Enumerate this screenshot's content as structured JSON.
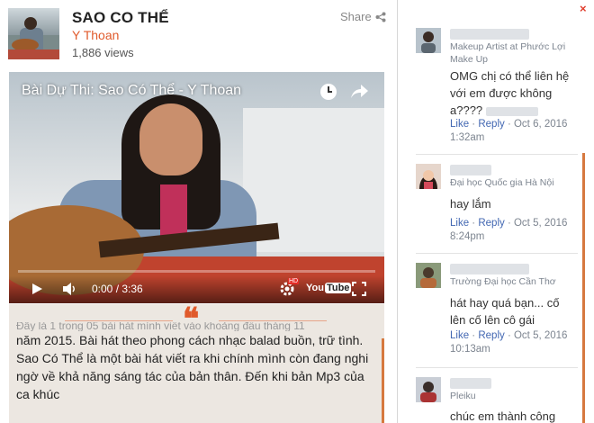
{
  "video": {
    "title": "SAO CO THỂ",
    "author": "Y Thoan",
    "views": "1,886 views",
    "share_label": "Share",
    "player_title": "Bài Dự Thi: Sao Có Thể - Y Thoan",
    "time": "0:00 / 3:36",
    "progress": 0,
    "youtube_label": "You",
    "youtube_tube": "Tube",
    "hd_label": "HD"
  },
  "description": {
    "quote_glyph": "❝",
    "faded_line": "Đây là 1 trong 05 bài hát mình viết vào khoảng đầu tháng 11",
    "text": "năm 2015. Bài hát theo phong cách nhạc balad buồn, trữ tình. Sao Có Thể là một bài hát viết ra khi chính mình còn đang nghi ngờ về khả năng sáng tác của bản thân. Đến khi bản Mp3 của ca khúc"
  },
  "comments_panel": {
    "close_glyph": "×",
    "comments": [
      {
        "place": "Makeup Artist at Phước Lợi Make Up",
        "text": "OMG chị có thể liên hệ với em được không a????",
        "like": "Like",
        "reply": "Reply",
        "date": "Oct 6, 2016",
        "time": "1:32am"
      },
      {
        "place": "Đại học Quốc gia Hà Nội",
        "text": "hay lắm",
        "like": "Like",
        "reply": "Reply",
        "date": "Oct 5, 2016",
        "time": "8:24pm"
      },
      {
        "place": "Trường Đại học Cần Thơ",
        "text": "hát hay quá bạn... cố lên cố lên cô gái",
        "like": "Like",
        "reply": "Reply",
        "date": "Oct 5, 2016",
        "time": "10:13am"
      },
      {
        "place": "Pleiku",
        "text": "chúc em thành công"
      }
    ]
  },
  "colors": {
    "accent": "#e05a2b",
    "link": "#4267b2",
    "scroll": "#d6793f"
  }
}
